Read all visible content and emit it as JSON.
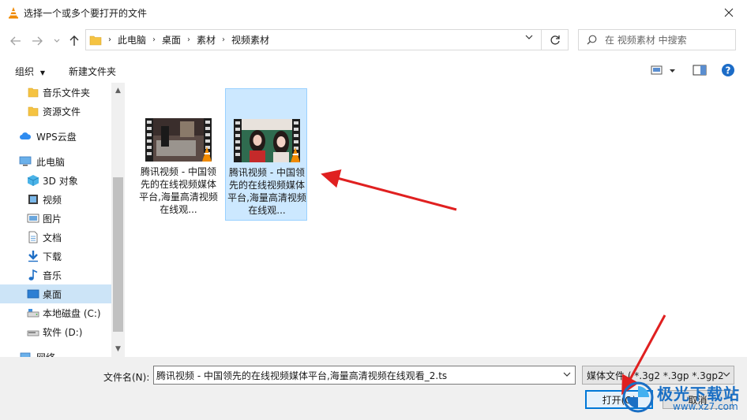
{
  "window": {
    "title": "选择一个或多个要打开的文件"
  },
  "address": {
    "crumbs": [
      "此电脑",
      "桌面",
      "素材",
      "视频素材"
    ]
  },
  "search": {
    "placeholder": "在 视频素材 中搜索"
  },
  "toolbar": {
    "organize_label": "组织",
    "new_folder_label": "新建文件夹"
  },
  "sidebar": {
    "items": [
      {
        "label": "音乐文件夹",
        "icon": "folder-icon"
      },
      {
        "label": "资源文件",
        "icon": "folder-icon"
      },
      {
        "label": "WPS云盘",
        "icon": "cloud-icon"
      },
      {
        "label": "此电脑",
        "icon": "computer-icon"
      },
      {
        "label": "3D 对象",
        "icon": "3d-objects-icon"
      },
      {
        "label": "视频",
        "icon": "video-icon"
      },
      {
        "label": "图片",
        "icon": "pictures-icon"
      },
      {
        "label": "文档",
        "icon": "documents-icon"
      },
      {
        "label": "下载",
        "icon": "download-icon"
      },
      {
        "label": "音乐",
        "icon": "music-icon"
      },
      {
        "label": "桌面",
        "icon": "desktop-icon",
        "selected": true
      },
      {
        "label": "本地磁盘 (C:)",
        "icon": "drive-c-icon"
      },
      {
        "label": "软件 (D:)",
        "icon": "drive-d-icon"
      },
      {
        "label": "网络",
        "icon": "network-icon"
      }
    ]
  },
  "files": [
    {
      "name": "腾讯视频 - 中国领先的在线视频媒体平台,海量高清视频在线观...",
      "selected": false
    },
    {
      "name": "腾讯视频 - 中国领先的在线视频媒体平台,海量高清视频在线观...",
      "selected": true
    }
  ],
  "footer": {
    "filename_label": "文件名(N):",
    "filename_value": "腾讯视频 - 中国领先的在线视频媒体平台,海量高清视频在线观看_2.ts",
    "filter_value": "媒体文件 ( *.3g2 *.3gp *.3gp2",
    "open_label": "打开(O)",
    "cancel_label": "取消"
  },
  "watermark": {
    "text": "极光下载站",
    "url": "www.xz7.com"
  },
  "colors": {
    "selection": "#cce8ff",
    "accent": "#0078d7",
    "arrow": "#e02020"
  }
}
